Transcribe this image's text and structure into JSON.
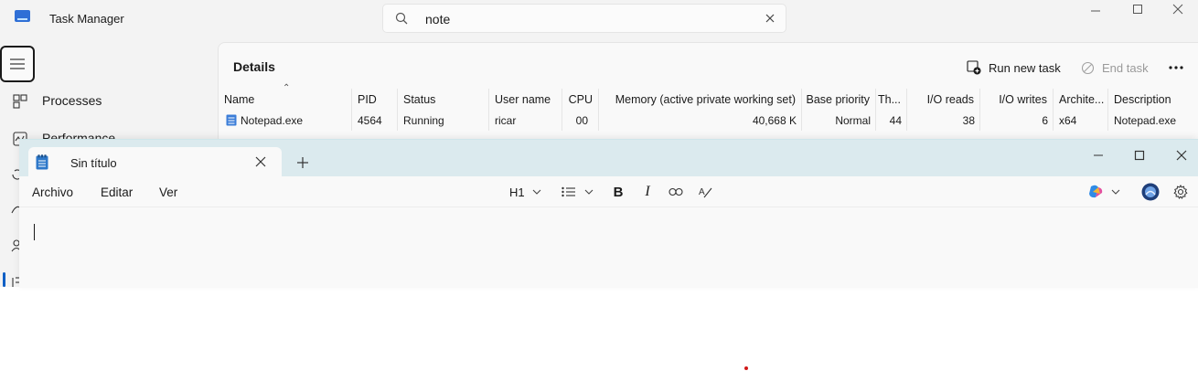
{
  "task_manager": {
    "title": "Task Manager",
    "search": {
      "value": "note",
      "placeholder": ""
    },
    "nav": [
      {
        "label": "Processes",
        "icon": "processes-icon"
      },
      {
        "label": "Performance",
        "icon": "performance-icon"
      }
    ],
    "page_title": "Details",
    "toolbar": {
      "run_new_task": "Run new task",
      "end_task": "End task",
      "more": "..."
    },
    "table": {
      "columns": [
        "Name",
        "PID",
        "Status",
        "User name",
        "CPU",
        "Memory (active private working set)",
        "Base priority",
        "Th...",
        "I/O reads",
        "I/O writes",
        "Archite...",
        "Description"
      ],
      "rows": [
        [
          "Notepad.exe",
          "4564",
          "Running",
          "ricar",
          "00",
          "40,668 K",
          "Normal",
          "44",
          "38",
          "6",
          "x64",
          "Notepad.exe"
        ]
      ]
    }
  },
  "notepad": {
    "tab_title": "Sin título",
    "menu": [
      "Archivo",
      "Editar",
      "Ver"
    ],
    "toolbar": {
      "heading": "H1"
    },
    "editor_text": ""
  }
}
